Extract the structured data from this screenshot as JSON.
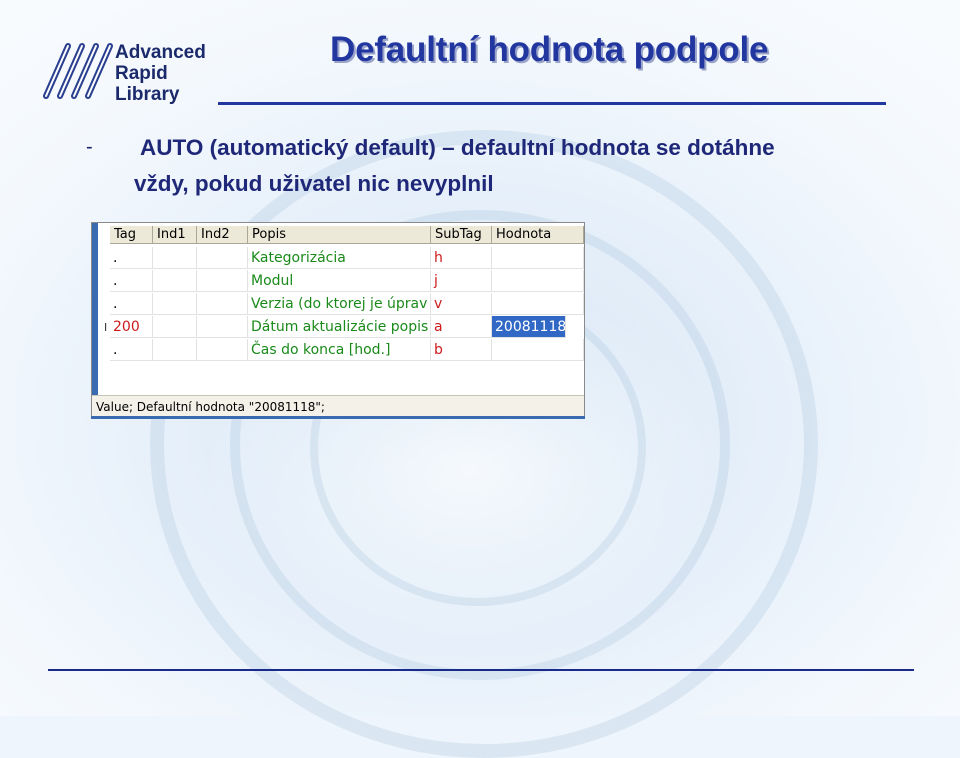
{
  "logo": {
    "line1": "Advanced",
    "line2": "Rapid",
    "line3": "Library"
  },
  "slide": {
    "title": "Defaultní hodnota podpole",
    "bullet_marker": "-",
    "bullet_line1": "AUTO (automatický default) – defaultní hodnota se dotáhne",
    "bullet_line2": "vždy, pokud uživatel nic nevyplnil"
  },
  "grid": {
    "columns": [
      "Tag",
      "Ind1",
      "Ind2",
      "Popis",
      "SubTag",
      "Hodnota"
    ],
    "rows": [
      {
        "indicator": "",
        "tag": ".",
        "ind1": "",
        "ind2": "",
        "popis": "Kategorizácia",
        "subtag": "h",
        "hodnota": ""
      },
      {
        "indicator": "",
        "tag": ".",
        "ind1": "",
        "ind2": "",
        "popis": "Modul",
        "subtag": "j",
        "hodnota": ""
      },
      {
        "indicator": "",
        "tag": ".",
        "ind1": "",
        "ind2": "",
        "popis": "Verzia (do ktorej je úprav",
        "subtag": "v",
        "hodnota": ""
      },
      {
        "indicator": "I",
        "tag": "200",
        "ind1": "",
        "ind2": "",
        "popis": "Dátum aktualizácie popis",
        "subtag": "a",
        "hodnota": "20081118"
      },
      {
        "indicator": "",
        "tag": ".",
        "ind1": "",
        "ind2": "",
        "popis": "Čas do konca [hod.]",
        "subtag": "b",
        "hodnota": ""
      }
    ],
    "status_text": "Value; Defaultní hodnota \"20081118\";"
  },
  "colors": {
    "title": "#2236a0",
    "bullet": "#1f2878",
    "popis_text": "#1a8a1a",
    "subtag_text": "#cc1a1a",
    "selection": "#3168c6"
  }
}
